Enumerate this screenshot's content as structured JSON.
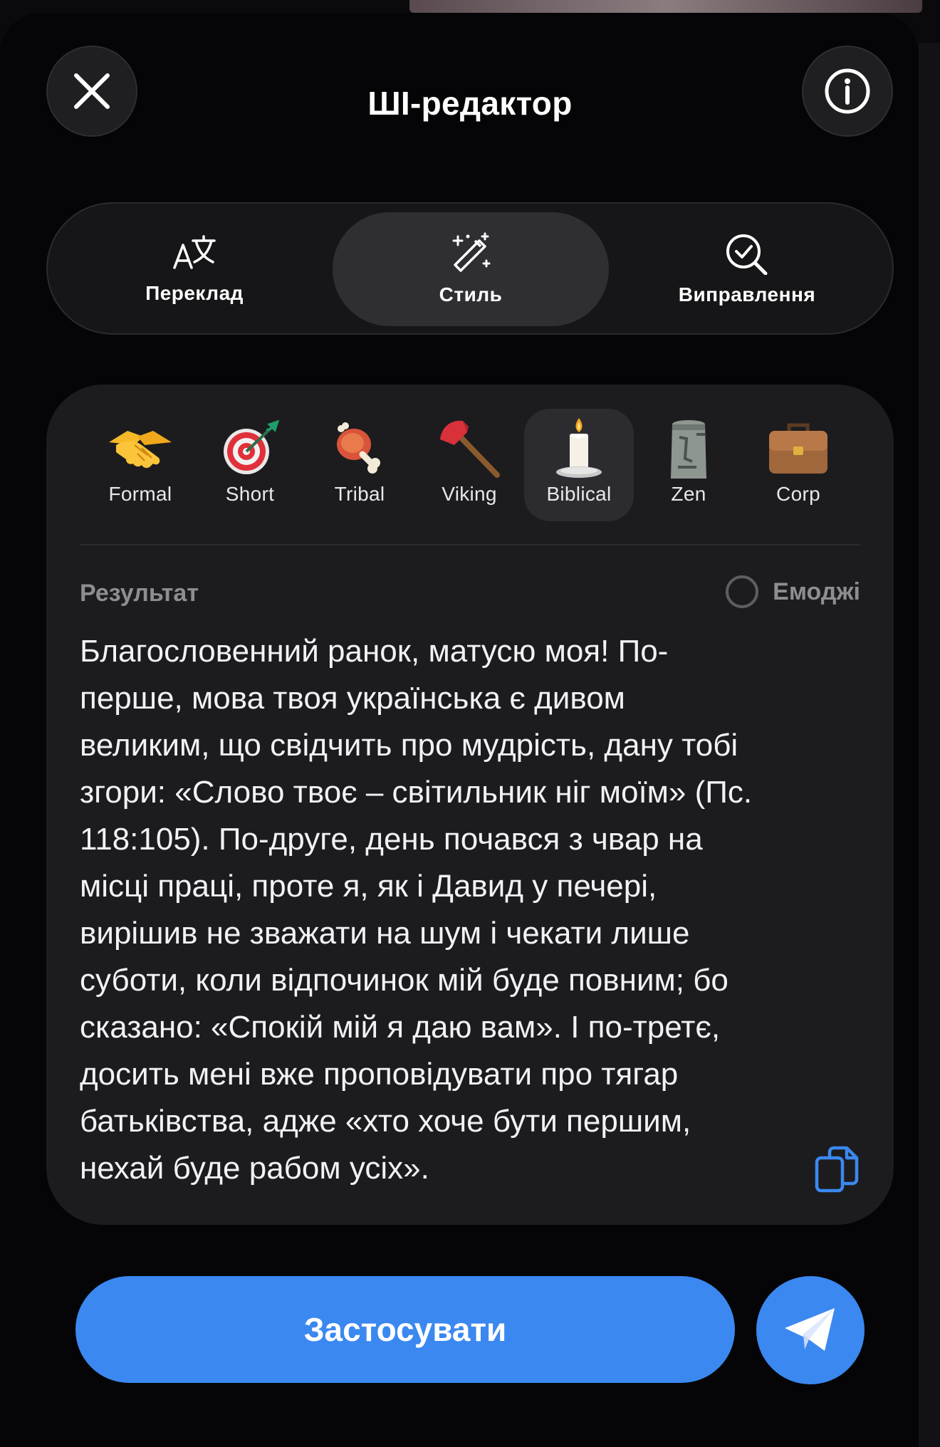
{
  "header": {
    "title": "ШІ-редактор",
    "close_icon": "close-icon",
    "info_icon": "info-icon"
  },
  "tabs": [
    {
      "label": "Переклад",
      "icon": "translate-icon"
    },
    {
      "label": "Стиль",
      "icon": "magic-wand-icon",
      "active": true
    },
    {
      "label": "Виправлення",
      "icon": "spellcheck-icon"
    }
  ],
  "styles": [
    {
      "name": "Formal",
      "icon": "handshake-icon"
    },
    {
      "name": "Short",
      "icon": "target-icon"
    },
    {
      "name": "Tribal",
      "icon": "meat-on-bone-icon"
    },
    {
      "name": "Viking",
      "icon": "axe-icon"
    },
    {
      "name": "Biblical",
      "icon": "candle-icon",
      "active": true
    },
    {
      "name": "Zen",
      "icon": "moai-icon"
    },
    {
      "name": "Corp",
      "icon": "briefcase-icon"
    }
  ],
  "result": {
    "label": "Результат",
    "emoji_toggle_label": "Емоджі",
    "emoji_enabled": false,
    "text": "Благословенний ранок, матусю моя! По-\nперше, мова твоя українська є дивом\nвеликим, що свідчить про мудрість, дану тобі\nзгори: «Слово твоє – світильник ніг моїм» (Пс.\n118:105). По-друге, день почався з чвар на\nмісці праці, проте я, як і Давид у печері,\nвирішив не зважати на шум і чекати лише\nсуботи, коли відпочинок мій буде повним; бо\nсказано: «Спокій мій я даю вам». І по-третє,\nдосить мені вже проповідувати про тягар\nбатьківства, адже «хто хоче бути першим,\nнехай буде рабом усіх».",
    "copy_icon": "copy-icon"
  },
  "actions": {
    "apply_label": "Застосувати",
    "send_icon": "send-icon"
  },
  "colors": {
    "accent": "#3b88f0",
    "card": "#1c1c1e",
    "muted_text": "#8d8d92"
  }
}
